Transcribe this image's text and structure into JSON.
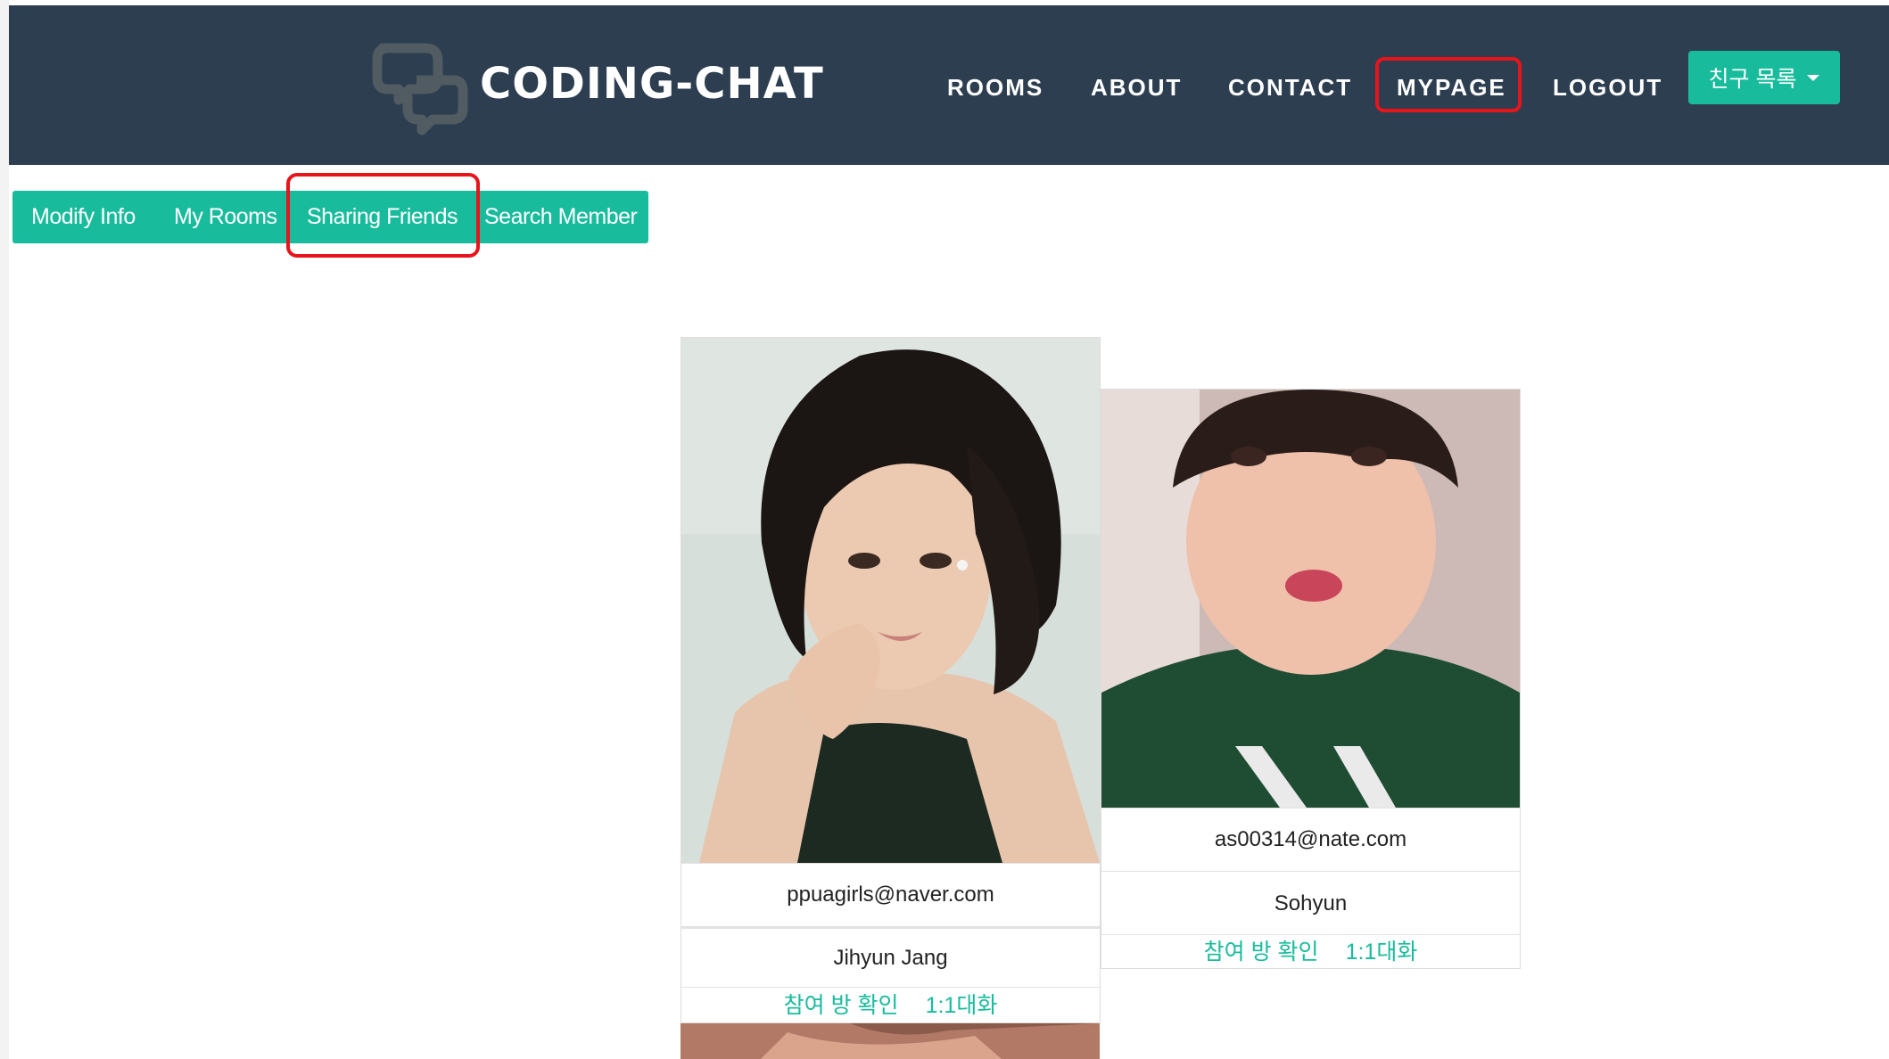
{
  "navbar": {
    "brand": "CODING-CHAT",
    "links": {
      "rooms": "ROOMS",
      "about": "ABOUT",
      "contact": "CONTACT",
      "mypage": "MYPAGE",
      "logout": "LOGOUT"
    },
    "friends_dropdown": "친구 목록",
    "logo_icon": "chat-bubbles-icon",
    "dropdown_icon": "caret-down-icon"
  },
  "subnav": {
    "tabs": [
      "Modify Info",
      "My Rooms",
      "Sharing Friends",
      "Search Member"
    ]
  },
  "friends": [
    {
      "email": "ppuagirls@naver.com",
      "name": "Jihyun Jang",
      "check_rooms": "참여 방 확인",
      "one_on_one": "1:1대화"
    },
    {
      "email": "as00314@nate.com",
      "name": "Sohyun",
      "check_rooms": "참여 방 확인",
      "one_on_one": "1:1대화"
    }
  ],
  "colors": {
    "navbar_bg": "#2c3e50",
    "accent": "#18bc9c",
    "highlight": "#e8141b"
  }
}
